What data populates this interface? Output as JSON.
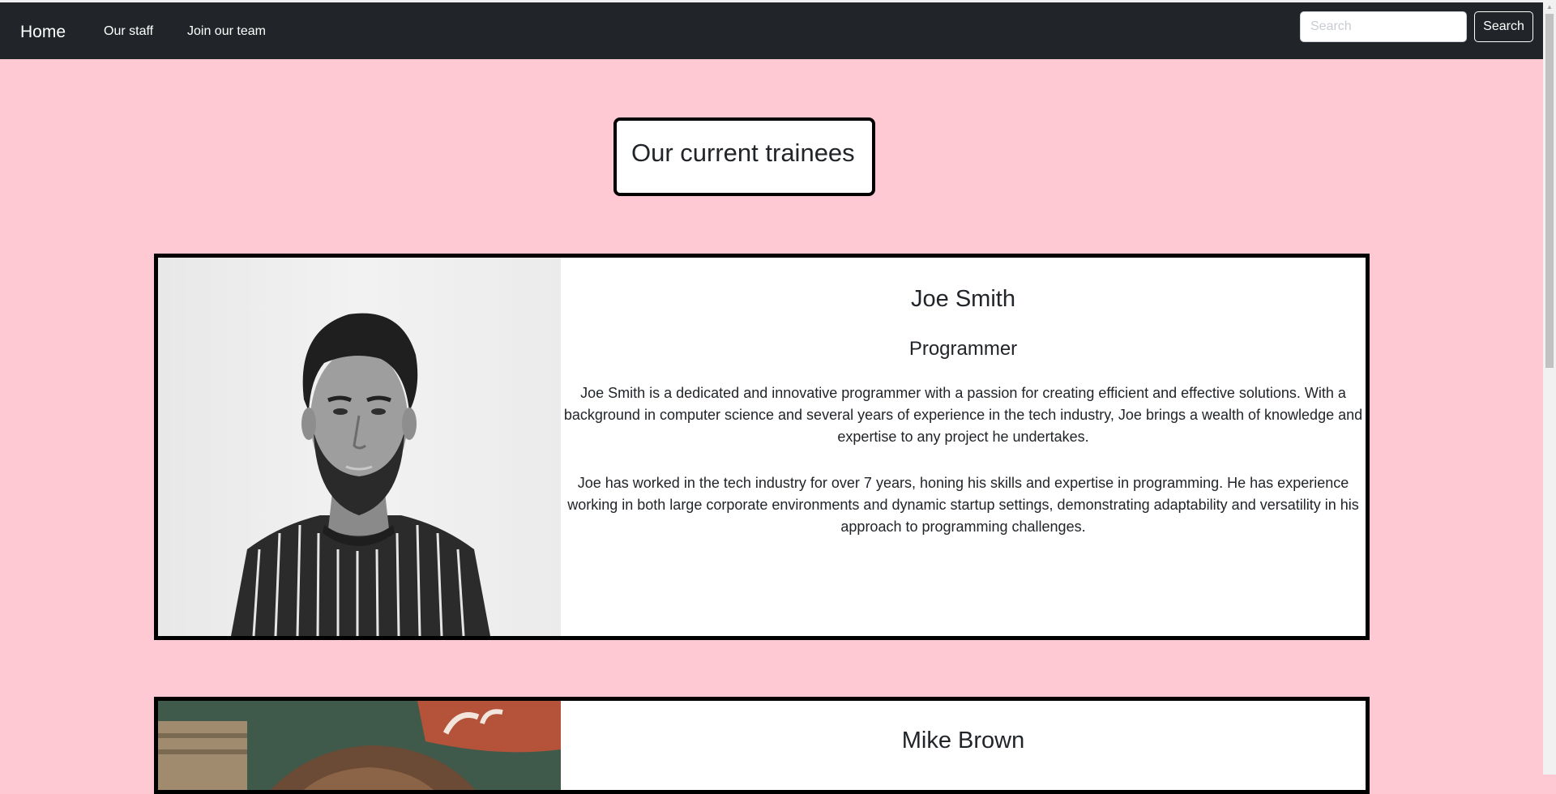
{
  "nav": {
    "brand": "Home",
    "links": [
      "Our staff",
      "Join our team"
    ],
    "search_placeholder": "Search",
    "search_button": "Search"
  },
  "page": {
    "heading": "Our current trainees"
  },
  "trainees": [
    {
      "name": "Joe Smith",
      "role": "Programmer",
      "bio": [
        "Joe Smith is a dedicated and innovative programmer with a passion for creating efficient and effective solutions. With a background in computer science and several years of experience in the tech industry, Joe brings a wealth of knowledge and expertise to any project he undertakes.",
        "Joe has worked in the tech industry for over 7 years, honing his skills and expertise in programming. He has experience working in both large corporate environments and dynamic startup settings, demonstrating adaptability and versatility in his approach to programming challenges."
      ]
    },
    {
      "name": "Mike Brown"
    }
  ]
}
